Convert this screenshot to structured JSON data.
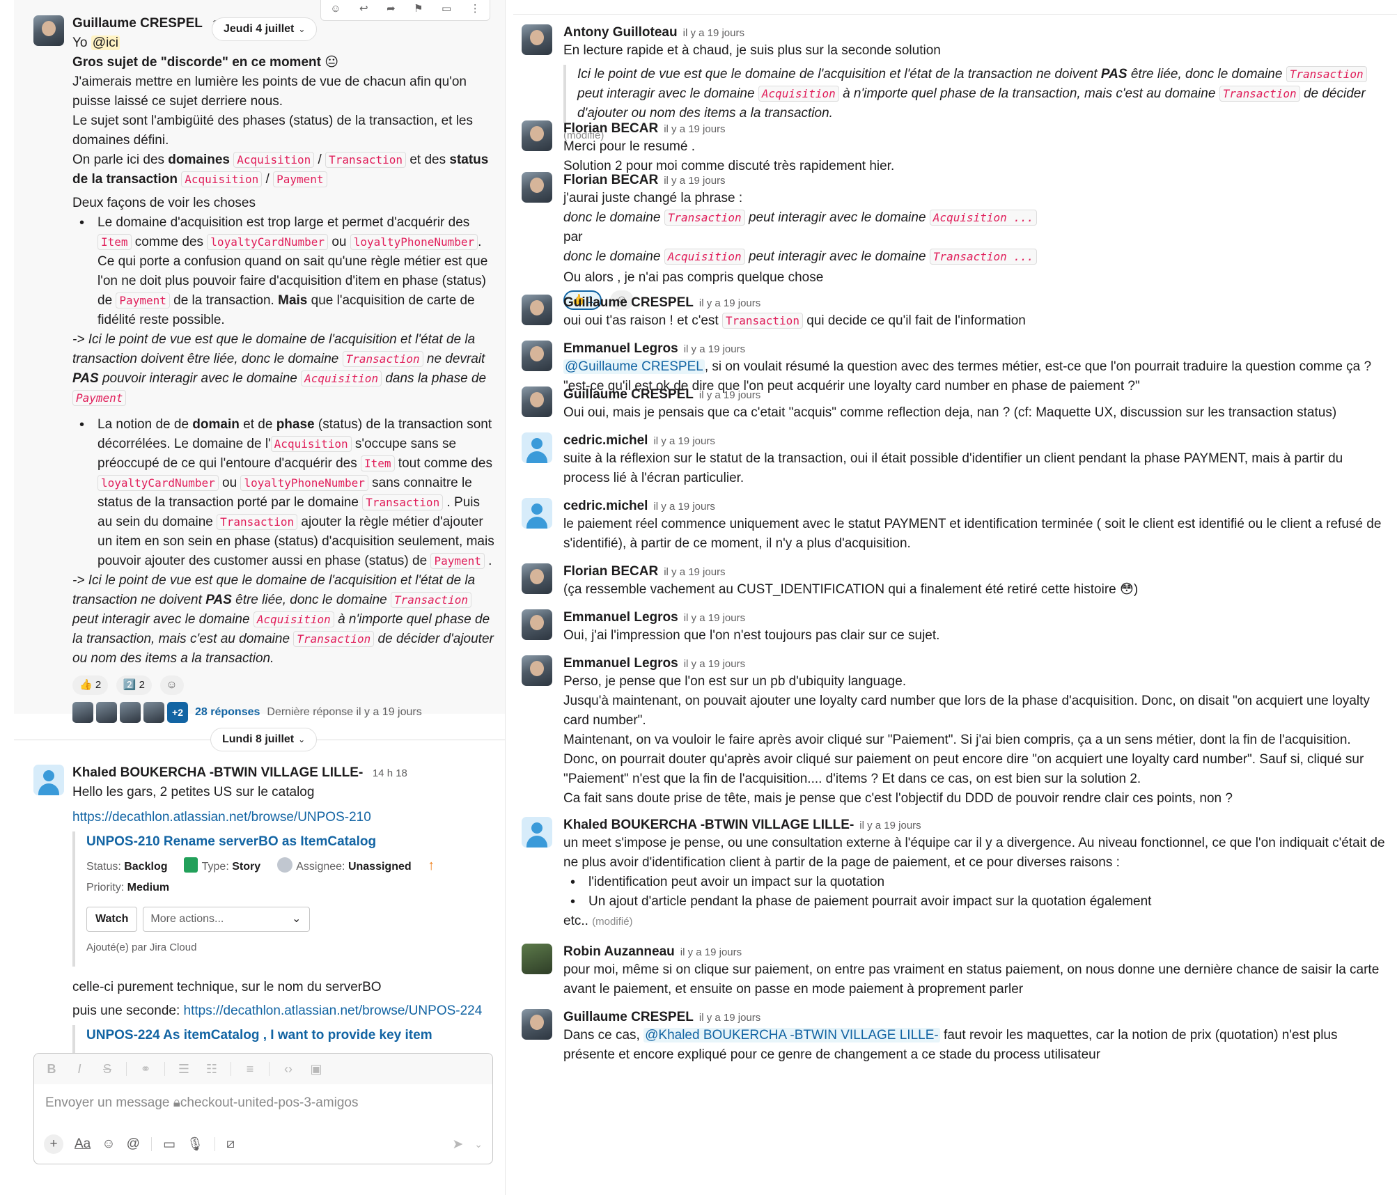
{
  "left": {
    "msg1": {
      "author": "Guillaume CRESPEL",
      "time": "10",
      "date_pill": "Jeudi 4 juillet",
      "line1_prefix": "Yo ",
      "line1_mention": "@ici",
      "line2": "Gros sujet de \"discorde\" en ce moment",
      "line2_emoji": "😐",
      "para1": "J'aimerais mettre en lumière les points de vue de chacun afin qu'on puisse laissé ce sujet derriere nous.",
      "para2": "Le sujet sont l'ambigüité des phases (status) de la transaction, et les domaines défini.",
      "para3_a": "On parle ici des ",
      "para3_b": "domaines",
      "para3_code1": "Acquisition",
      "para3_slash": " / ",
      "para3_code2": "Transaction",
      "para3_c": " et des ",
      "para3_d": "status de la transaction",
      "para3_code3": "Acquisition",
      "para3_code4": "Payment",
      "two_ways": "Deux façons de voir les choses",
      "b1_a": "Le domaine d'acquisition est trop large et permet d'acquérir des ",
      "b1_code1": "Item",
      "b1_b": " comme des ",
      "b1_code2": "loyaltyCardNumber",
      "b1_c": " ou ",
      "b1_code3": "loyaltyPhoneNumber",
      "b1_d": ". Ce qui porte a confusion quand on sait qu'une règle métier est que l'on ne doit plus pouvoir faire d'acquisition d'item en phase (status) de ",
      "b1_code4": "Payment",
      "b1_e": " de la transaction. ",
      "b1_bold": "Mais",
      "b1_f": "  que l'acquisition de carte de fidélité reste possible.",
      "view1_a": " -> Ici le point de vue est que le domaine de l'acquisition et l'état de la transaction doivent être liée, donc le domaine ",
      "view1_code1": "Transaction",
      "view1_b": " ne devrait ",
      "view1_bold": "PAS",
      "view1_c": " pouvoir interagir avec le domaine ",
      "view1_code2": "Acquisition",
      "view1_d": " dans la phase de ",
      "view1_code3": "Payment",
      "b2_a": "La notion de de ",
      "b2_bold1": "domain",
      "b2_b": " et de ",
      "b2_bold2": "phase",
      "b2_c": " (status) de la transaction sont décorrélées. Le domaine de l'",
      "b2_code1": "Acquisition",
      "b2_d": "  s'occupe sans se préoccupé de ce qui l'entoure d'acquérir des ",
      "b2_code2": "Item",
      "b2_e": " tout comme des ",
      "b2_code3": "loyaltyCardNumber",
      "b2_f": " ou ",
      "b2_code4": "loyaltyPhoneNumber",
      "b2_g": "  sans connaitre le status de la transaction porté par le domaine ",
      "b2_code5": "Transaction",
      "b2_h": " . Puis au sein du domaine ",
      "b2_code6": "Transaction",
      "b2_i": " ajouter la règle métier d'ajouter un item en son sein en phase (status) d'acquisition seulement, mais pouvoir ajouter des customer aussi en phase (status) de ",
      "b2_code7": "Payment",
      "b2_j": " .",
      "view2_a": "-> Ici le point de vue est que le domaine de l'acquisition et l'état de la transaction ne doivent ",
      "view2_bold": "PAS",
      "view2_b": " être liée, donc le domaine ",
      "view2_code1": "Transaction",
      "view2_c": " peut interagir avec le domaine ",
      "view2_code2": "Acquisition",
      "view2_d": " à n'importe quel phase de la transaction, mais c'est au domaine ",
      "view2_code3": "Transaction",
      "view2_e": " de décider d'ajouter ou nom des items a la transaction.",
      "reaction1": "👍 2",
      "reaction2": "2️⃣ 2",
      "thread_more": "+2",
      "thread_replies": "28 réponses",
      "thread_last": "Dernière réponse il y a 19 jours"
    },
    "date_pill2": "Lundi 8 juillet",
    "msg2": {
      "author": "Khaled BOUKERCHA -BTWIN VILLAGE LILLE-",
      "time": "14 h 18",
      "line1": "Hello les gars, 2 petites US sur le catalog",
      "link1": "https://decathlon.atlassian.net/browse/UNPOS-210",
      "unfurl_title": "UNPOS-210 Rename serverBO as ItemCatalog",
      "status_label": "Status: ",
      "status_value": "Backlog",
      "type_label": "Type: ",
      "type_value": "Story",
      "assignee_label": "Assignee: ",
      "assignee_value": "Unassigned",
      "priority_label": "Priority: ",
      "priority_value": "Medium",
      "watch": "Watch",
      "more_actions": "More actions...",
      "added_by": "Ajouté(e) par Jira Cloud",
      "line2": "celle-ci purement technique, sur le nom du serverBO",
      "line3_prefix": "puis une seconde: ",
      "link2": "https://decathlon.atlassian.net/browse/UNPOS-224",
      "unfurl2_title": "UNPOS-224 As itemCatalog , I want to provide key item"
    },
    "composer": {
      "placeholder": "Envoyer un message",
      "channel": "checkout-united-pos-3-amigos"
    }
  },
  "right": {
    "messages": [
      {
        "author": "Antony Guilloteau",
        "time": "il y a 19 jours"
      },
      {
        "author": "Florian BECAR",
        "time": "il y a 19 jours"
      },
      {
        "author": "Florian BECAR",
        "time": "il y a 19 jours"
      },
      {
        "author": "Guillaume CRESPEL",
        "time": "il y a 19 jours"
      },
      {
        "author": "Emmanuel Legros",
        "time": "il y a 19 jours"
      },
      {
        "author": "Guillaume CRESPEL",
        "time": "il y a 19 jours"
      },
      {
        "author": "cedric.michel",
        "time": "il y a 19 jours"
      },
      {
        "author": "cedric.michel",
        "time": "il y a 19 jours"
      },
      {
        "author": "Florian BECAR",
        "time": "il y a 19 jours"
      },
      {
        "author": "Emmanuel Legros",
        "time": "il y a 19 jours"
      },
      {
        "author": "Emmanuel Legros",
        "time": "il y a 19 jours"
      },
      {
        "author": "Khaled BOUKERCHA -BTWIN VILLAGE LILLE-",
        "time": "il y a 19 jours"
      },
      {
        "author": "Robin Auzanneau",
        "time": "il y a 19 jours"
      },
      {
        "author": "Guillaume CRESPEL",
        "time": "il y a 19 jours"
      }
    ],
    "m0_line1": "En lecture rapide et à chaud, je suis plus sur la seconde solution",
    "m0_q_a": "Ici le point de vue est que le domaine de l'acquisition et l'état de la transaction ne doivent ",
    "m0_q_bold": "PAS",
    "m0_q_b": " être liée, donc le domaine ",
    "m0_q_code1": "Transaction",
    "m0_q_c": " peut interagir avec le domaine ",
    "m0_q_code2": "Acquisition",
    "m0_q_d": " à n'importe quel phase de la transaction, mais c'est au domaine ",
    "m0_q_code3": "Transaction",
    "m0_q_e": " de décider d'ajouter ou nom des items a la transaction.",
    "m0_edited": "(modifié)",
    "m1_line1": "Merci pour le resumé .",
    "m1_line2": "Solution 2 pour moi comme discuté très rapidement hier.",
    "m2_line1": "j'aurai juste changé la phrase :",
    "m2_l2_a": "donc le domaine ",
    "m2_l2_code1": "Transaction",
    "m2_l2_b": " peut interagir avec le domaine ",
    "m2_l2_code2": "Acquisition ...",
    "m2_line3": "par",
    "m2_l4_a": "donc le domaine ",
    "m2_l4_code1": "Acquisition",
    "m2_l4_b": " peut interagir avec le domaine ",
    "m2_l4_code2": "Transaction ...",
    "m2_line5": "Ou alors , je n'ai pas compris quelque chose",
    "m2_reaction": "👍 1",
    "m3_a": "oui oui t'as raison ! et c'est ",
    "m3_code": "Transaction",
    "m3_b": " qui decide ce qu'il fait de l'information",
    "m4_mention": "@Guillaume CRESPEL",
    "m4_a": ", si on voulait résumé la question avec des termes métier, est-ce que l'on pourrait traduire la question comme ça ?",
    "m4_b": "\"est-ce qu'il est ok de dire que l'on peut acquérir une loyalty card number en phase de paiement ?\"",
    "m5": "Oui oui, mais je pensais que ca c'etait \"acquis\" comme reflection deja, nan ? (cf: Maquette UX, discussion sur les transaction status)",
    "m6": "suite à la réflexion sur le statut de la transaction, oui il était possible d'identifier un client pendant la phase PAYMENT, mais à partir du process lié à l'écran particulier.",
    "m7": "le paiement réel commence uniquement avec le statut PAYMENT et identification terminée ( soit le client est identifié ou le client a refusé de s'identifié), à partir de ce moment, il n'y a plus d'acquisition.",
    "m8_a": "(ça ressemble vachement au CUST_IDENTIFICATION qui a finalement été retiré cette histoire ",
    "m8_emoji": "😳",
    "m8_b": ")",
    "m9": "Oui, j'ai l'impression que l'on n'est toujours pas clair sur ce sujet.",
    "m10_l1": "Perso, je pense que l'on est sur un pb d'ubiquity language.",
    "m10_l2": "Jusqu'à maintenant, on pouvait ajouter une loyalty card number que lors de la phase d'acquisition. Donc, on disait \"on acquiert une loyalty card number\".",
    "m10_l3": "Maintenant, on va vouloir le faire après avoir cliqué sur \"Paiement\". Si j'ai bien compris, ça a un sens métier, dont la fin de l'acquisition.",
    "m10_l4": "Donc, on pourrait douter qu'après avoir cliqué sur paiement on peut encore dire \"on acquiert une loyalty card number\". Sauf si, cliqué sur \"Paiement\" n'est que la fin de l'acquisition.... d'items ? Et dans ce cas, on est bien sur la solution 2.",
    "m10_l5": "Ca fait sans doute prise de tête, mais je pense que c'est l'objectif du DDD de pouvoir rendre clair ces points, non ?",
    "m11_l1": "un meet s'impose je pense, ou une consultation externe à l'équipe car il y a divergence. Au niveau fonctionnel, ce que l'on indiquait c'était de ne plus avoir d'identification client à partir de la page de paiement, et ce pour diverses raisons :",
    "m11_b1": " l'identification peut avoir un impact sur la quotation",
    "m11_b2": "Un ajout d'article pendant la phase de paiement pourrait avoir impact sur la quotation également",
    "m11_etc": "etc..",
    "m11_edited": "(modifié)",
    "m12": "pour moi, même si on clique sur paiement, on entre pas vraiment en status paiement, on nous donne une dernière chance de saisir la carte avant le paiement, et ensuite on passe en mode paiement à proprement parler",
    "m13_a": "Dans ce cas, ",
    "m13_mention": "@Khaled BOUKERCHA -BTWIN VILLAGE LILLE-",
    "m13_b": " faut revoir les maquettes, car la notion de prix (quotation) n'est plus présente et encore expliqué pour ce genre de changement a ce stade du process utilisateur"
  }
}
